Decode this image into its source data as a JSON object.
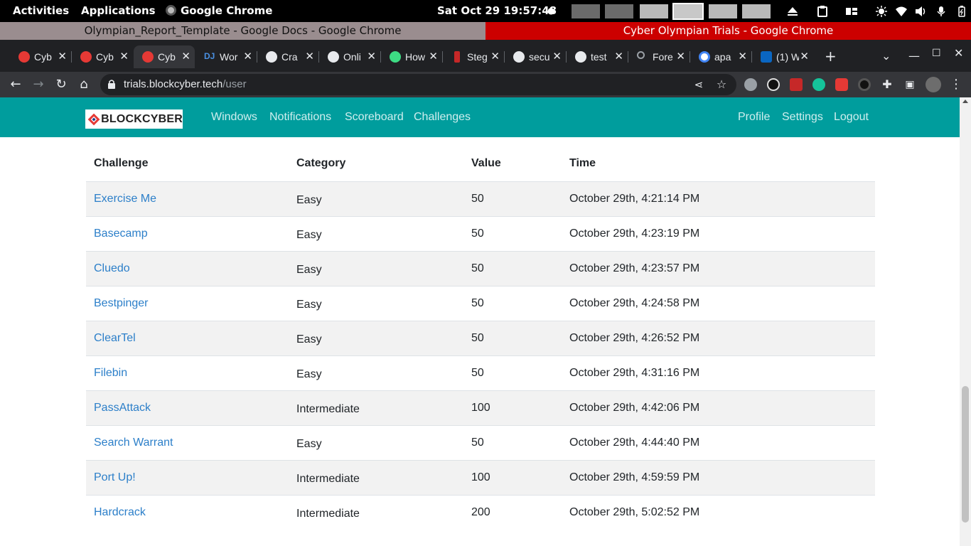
{
  "gnome": {
    "activities": "Activities",
    "applications": "Applications",
    "app_name": "Google Chrome",
    "clock": "Sat Oct 29  19:57:48",
    "dot": "●"
  },
  "windows": {
    "left_title": "Olympian_Report_Template - Google Docs - Google Chrome",
    "right_title": "Cyber Olympian Trials - Google Chrome"
  },
  "tabs": [
    {
      "label": "Cyb",
      "favicon": "blockcyber-icon",
      "color": "#e53935"
    },
    {
      "label": "Cyb",
      "favicon": "blockcyber-icon",
      "color": "#e53935"
    },
    {
      "label": "Cyb",
      "favicon": "blockcyber-icon",
      "color": "#e53935"
    },
    {
      "label": "Wor",
      "favicon": "dj-icon",
      "color": "#4a90e2"
    },
    {
      "label": "Cra",
      "favicon": "globe-icon",
      "color": "#e8eaed"
    },
    {
      "label": "Onli",
      "favicon": "skull-icon",
      "color": "#e8eaed"
    },
    {
      "label": "How",
      "favicon": "android-icon",
      "color": "#3ddc84"
    },
    {
      "label": "Steg",
      "favicon": "steg-icon",
      "color": "#c62828"
    },
    {
      "label": "secu",
      "favicon": "globe-icon",
      "color": "#e8eaed"
    },
    {
      "label": "test",
      "favicon": "globe-icon",
      "color": "#e8eaed"
    },
    {
      "label": "Fore",
      "favicon": "search-icon",
      "color": "#9aa0a6"
    },
    {
      "label": "apa",
      "favicon": "google-icon",
      "color": "#4285f4"
    },
    {
      "label": "(1) W",
      "favicon": "linkedin-icon",
      "color": "#0a66c2"
    }
  ],
  "toolbar": {
    "url_host": "trials.blockcyber.tech",
    "url_path": "/user"
  },
  "site": {
    "brand": "BLOCKCYBER",
    "nav_left": [
      "Windows",
      "Notifications",
      "Scoreboard",
      "Challenges"
    ],
    "nav_right": [
      "Profile",
      "Settings",
      "Logout"
    ]
  },
  "solves": {
    "headers": [
      "Challenge",
      "Category",
      "Value",
      "Time"
    ],
    "rows": [
      {
        "challenge": "Exercise Me",
        "category": "Easy",
        "value": "50",
        "time": "October 29th, 4:21:14 PM"
      },
      {
        "challenge": "Basecamp",
        "category": "Easy",
        "value": "50",
        "time": "October 29th, 4:23:19 PM"
      },
      {
        "challenge": "Cluedo",
        "category": "Easy",
        "value": "50",
        "time": "October 29th, 4:23:57 PM"
      },
      {
        "challenge": "Bestpinger",
        "category": "Easy",
        "value": "50",
        "time": "October 29th, 4:24:58 PM"
      },
      {
        "challenge": "ClearTel",
        "category": "Easy",
        "value": "50",
        "time": "October 29th, 4:26:52 PM"
      },
      {
        "challenge": "Filebin",
        "category": "Easy",
        "value": "50",
        "time": "October 29th, 4:31:16 PM"
      },
      {
        "challenge": "PassAttack",
        "category": "Intermediate",
        "value": "100",
        "time": "October 29th, 4:42:06 PM"
      },
      {
        "challenge": "Search Warrant",
        "category": "Easy",
        "value": "50",
        "time": "October 29th, 4:44:40 PM"
      },
      {
        "challenge": "Port Up!",
        "category": "Intermediate",
        "value": "100",
        "time": "October 29th, 4:59:59 PM"
      },
      {
        "challenge": "Hardcrack",
        "category": "Intermediate",
        "value": "200",
        "time": "October 29th, 5:02:52 PM"
      }
    ]
  }
}
